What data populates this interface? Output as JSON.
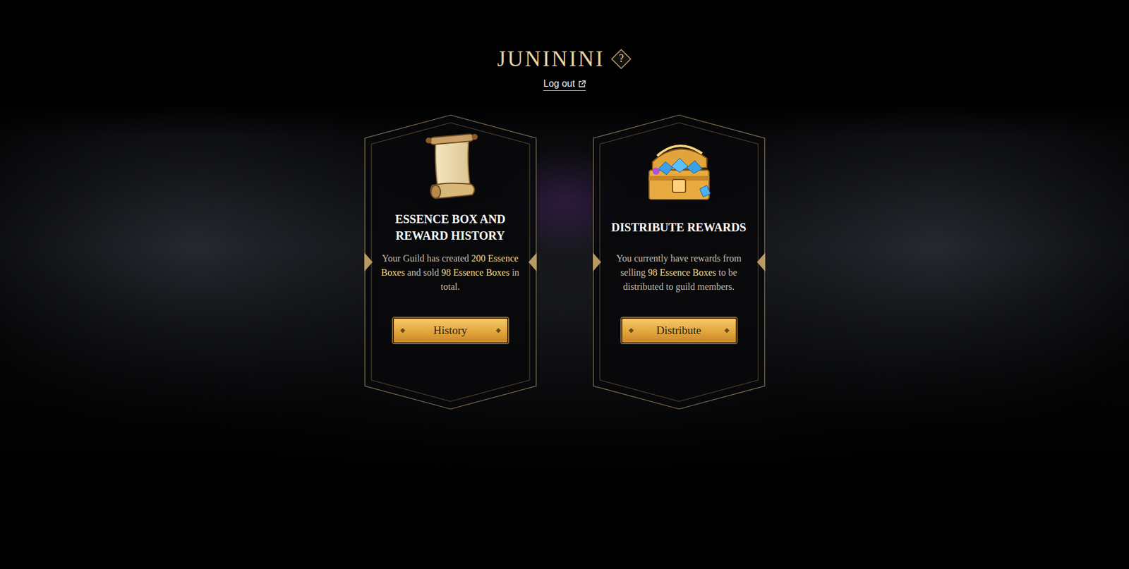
{
  "header": {
    "title": "JUNININI",
    "help": "?",
    "logout": "Log out"
  },
  "cards": [
    {
      "title": "ESSENCE BOX AND REWARD HISTORY",
      "description": [
        {
          "text": "Your Guild has created ",
          "highlight": false
        },
        {
          "text": "200 Essence Boxes",
          "highlight": true
        },
        {
          "text": " and sold ",
          "highlight": false
        },
        {
          "text": "98 Essence Boxes",
          "highlight": true
        },
        {
          "text": " in total.",
          "highlight": false
        }
      ],
      "button": "History"
    },
    {
      "title": "DISTRIBUTE REWARDS",
      "description": [
        {
          "text": "You currently have rewards from selling ",
          "highlight": false
        },
        {
          "text": "98 Essence Boxes",
          "highlight": true
        },
        {
          "text": " to be distributed to guild members.",
          "highlight": false
        }
      ],
      "button": "Distribute"
    }
  ]
}
